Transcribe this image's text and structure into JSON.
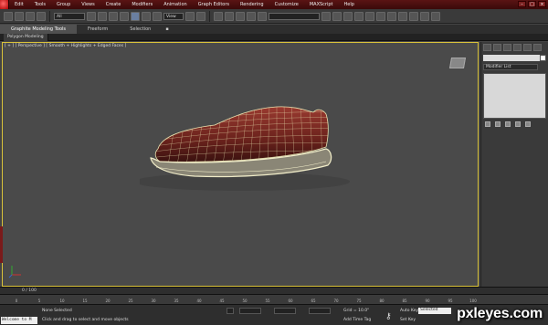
{
  "menubar": {
    "items": [
      "Edit",
      "Tools",
      "Group",
      "Views",
      "Create",
      "Modifiers",
      "Animation",
      "Graph Editors",
      "Rendering",
      "Customize",
      "MAXScript",
      "Help"
    ]
  },
  "toolbar": {
    "selection_filter": "All",
    "reference_coord": "View"
  },
  "ribbon": {
    "tabs": [
      "Graphite Modeling Tools",
      "Freeform",
      "Selection"
    ],
    "panel": "Polygon Modeling"
  },
  "viewport": {
    "label": "[ + ] [ Perspective ] [ Smooth + Highlights + Edged Faces ]"
  },
  "command_panel": {
    "modifier_list": "Modifier List"
  },
  "timeslider": {
    "position": "0 / 100"
  },
  "trackbar": {
    "ticks": [
      "0",
      "5",
      "10",
      "15",
      "20",
      "25",
      "30",
      "35",
      "40",
      "45",
      "50",
      "55",
      "60",
      "65",
      "70",
      "75",
      "80",
      "85",
      "90",
      "95",
      "100"
    ]
  },
  "status": {
    "maxscript": "Welcome to M",
    "selection": "None Selected",
    "prompt": "Click and drag to select and move objects",
    "grid": "Grid = 10.0\"",
    "add_time_tag": "Add Time Tag",
    "auto_key": "Auto Key",
    "set_key": "Set Key",
    "selected": "Selected"
  },
  "watermark": "pxleyes.com",
  "colors": {
    "viewport_border": "#d9c23a",
    "shoe_leather": "#7a2a22",
    "wire": "#e8e2b0",
    "title_bar": "#5a1414"
  }
}
